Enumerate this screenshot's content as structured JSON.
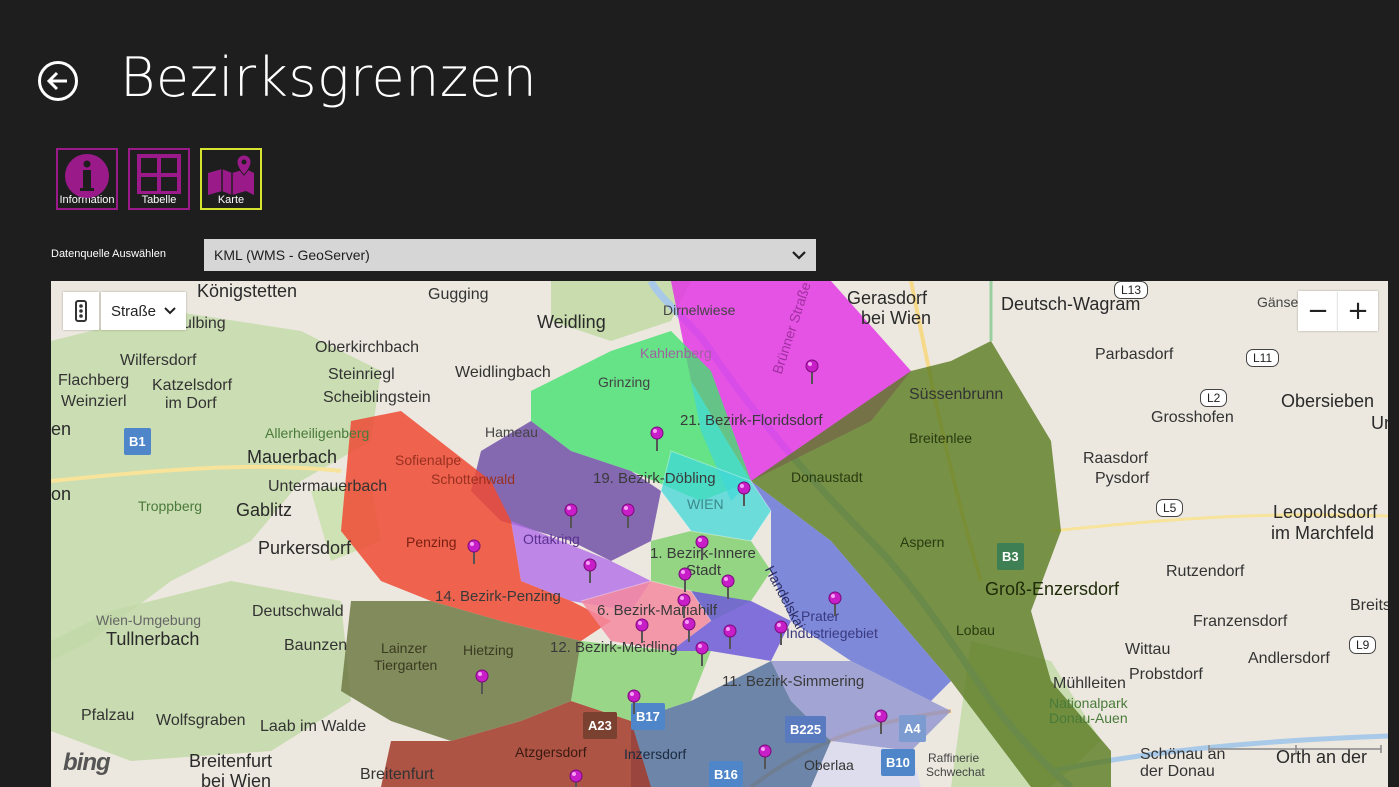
{
  "page": {
    "title": "Bezirksgrenzen"
  },
  "tiles": [
    {
      "label": "Information",
      "icon": "info-icon",
      "active": false
    },
    {
      "label": "Tabelle",
      "icon": "table-icon",
      "active": false
    },
    {
      "label": "Karte",
      "icon": "map-icon",
      "active": true
    }
  ],
  "datasource": {
    "label": "Datenquelle Auswählen",
    "selected": "KML (WMS - GeoServer)"
  },
  "map": {
    "style_selector": "Straße",
    "zoom_out": "−",
    "zoom_in": "+",
    "provider": "bing",
    "places": [
      "Königstetten",
      "Gugging",
      "Dirnelwiese",
      "Gerasdorf",
      "bei Wien",
      "Deutsch-Wagram",
      "Gänserndorf",
      "Weidling",
      "Oberkirchbach",
      "Steinriegl",
      "Scheiblingstein",
      "Weidlingbach",
      "Kahlenberg",
      "Wilfersdorf",
      "Flachberg",
      "Weinzierl",
      "Katzelsdorf",
      "im Dorf",
      "ulbing",
      "Parbasdorf",
      "Süssenbrunn",
      "Grinzing",
      "Obersieben",
      "Grosshofen",
      "Allerheiligenberg",
      "Hameau",
      "Mauerbach",
      "Sofienalpe",
      "Schottenwald",
      "Breitenlee",
      "Raasdorf",
      "Pysdorf",
      "Untermauerbach",
      "Donaustadt",
      "Troppberg",
      "Gablitz",
      "WIEN",
      "Leopoldsdorf",
      "im Marchfeld",
      "Purkersdorf",
      "Penzing",
      "Ottakring",
      "Aspern",
      "Rutzendorf",
      "Groß-Enzersdorf",
      "Wien-Umgebung",
      "Tullnerbach",
      "Deutschwald",
      "Prater",
      "Franzensdorf",
      "Breitstetten",
      "Lainzer",
      "Tiergarten",
      "Hietzing",
      "Industriegebiet",
      "Lobau",
      "Wittau",
      "Probstdorf",
      "Andlersdorf",
      "Baunzen",
      "Mühlleiten",
      "Pfalzau",
      "Wolfsgraben",
      "Laab im Walde",
      "Nationalpark",
      "Donau-Auen",
      "Atzgersdorf",
      "Inzersdorf",
      "Oberlaa",
      "Raffinerie",
      "Schwechat",
      "Schönau an",
      "der Donau",
      "Orth an der",
      "Breitenfurt",
      "bei Wien",
      "Breitenfurt",
      "Handelskai",
      "Brünner Straße",
      "Un",
      "en",
      "on"
    ],
    "districts": [
      "21. Bezirk-Floridsdorf",
      "19. Bezirk-Döbling",
      "1. Bezirk-Innere",
      "Stadt",
      "14. Bezirk-Penzing",
      "6. Bezirk-Mariahilf",
      "12. Bezirk-Meidling",
      "11. Bezirk-Simmering"
    ],
    "road_shields": [
      "B1",
      "B3",
      "B17",
      "B225",
      "B16",
      "B10",
      "A4",
      "A23",
      "L13",
      "L11",
      "L2",
      "L5",
      "L9"
    ],
    "colors": {
      "floridsdorf": "#e32de6",
      "donaustadt": "#5a7a20",
      "doebling": "#45e070",
      "innerestadt": "#40d8d8",
      "penzing": "#ef4a35",
      "hietzing": "#6e7a45",
      "meidling": "#7dd06a",
      "liesing": "#a23a2a",
      "favoriten": "#4e6b9a",
      "simmering": "#8a8fd0",
      "ottakring": "#b36ee8",
      "hernals": "#6a48a5",
      "landstrasse": "#6e5ad8",
      "margareten": "#f58aa0",
      "pin": "#c81ec8"
    }
  }
}
